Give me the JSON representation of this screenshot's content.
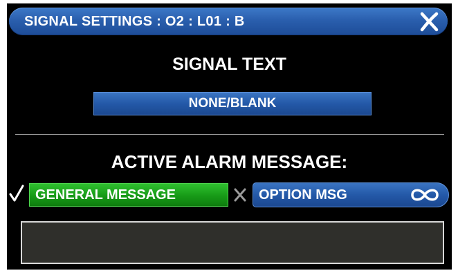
{
  "window": {
    "title": "SIGNAL SETTINGS : O2 : L01 : B",
    "close_icon": "close-x-icon"
  },
  "signal_text": {
    "heading": "SIGNAL TEXT",
    "selected_value": "NONE/BLANK"
  },
  "alarm": {
    "heading": "ACTIVE ALARM MESSAGE:",
    "general": {
      "label": "GENERAL MESSAGE",
      "state_icon": "checkmark-icon",
      "color": "#179a17",
      "active": true
    },
    "option": {
      "label": "OPTION MSG",
      "state_icon": "x-mark-icon",
      "trailing_icon": "infinity-icon",
      "color": "#2459a8",
      "active": false
    },
    "message_text": ""
  },
  "colors": {
    "background": "#000000",
    "accent_blue": "#2459a8",
    "active_green": "#179a17",
    "message_box": "#2f2f2b"
  }
}
